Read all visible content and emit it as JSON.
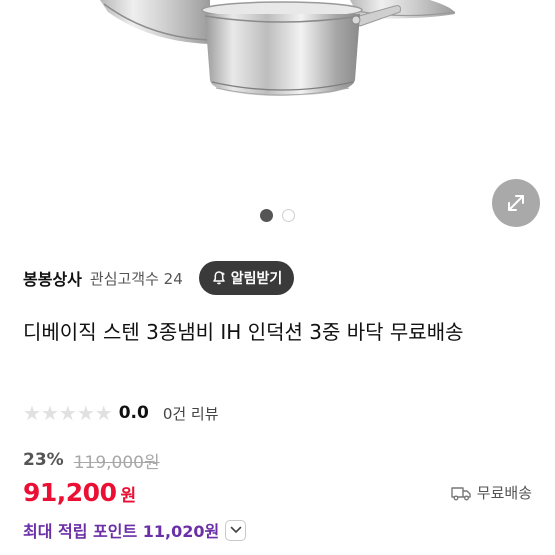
{
  "product": {
    "image_alt": "stainless steel pot set",
    "pager_total": 2,
    "pager_active": 1
  },
  "seller": {
    "name": "봉봉상사",
    "follower_text": "관심고객수 24",
    "alarm_button_label": "알림받기"
  },
  "title": "디베이직 스텐 3종냄비 IH 인덕션 3중 바닥 무료배송",
  "rating": {
    "value": "0.0",
    "stars_filled": 0,
    "stars_total": 5,
    "review_count": "0건 리뷰"
  },
  "pricing": {
    "discount_rate": "23%",
    "original_price": "119,000원",
    "sale_price": "91,200",
    "sale_unit": "원",
    "shipping_label": "무료배송",
    "points_text": "최대 적립 포인트 11,020원"
  },
  "colors": {
    "accent_red": "#ea0f33",
    "points_purple": "#6b2fa6",
    "dark_button": "#3a3a3a"
  },
  "icons": {
    "expand": "expand-icon",
    "bell": "bell-icon",
    "truck": "truck-icon",
    "chevron": "chevron-down-icon"
  }
}
